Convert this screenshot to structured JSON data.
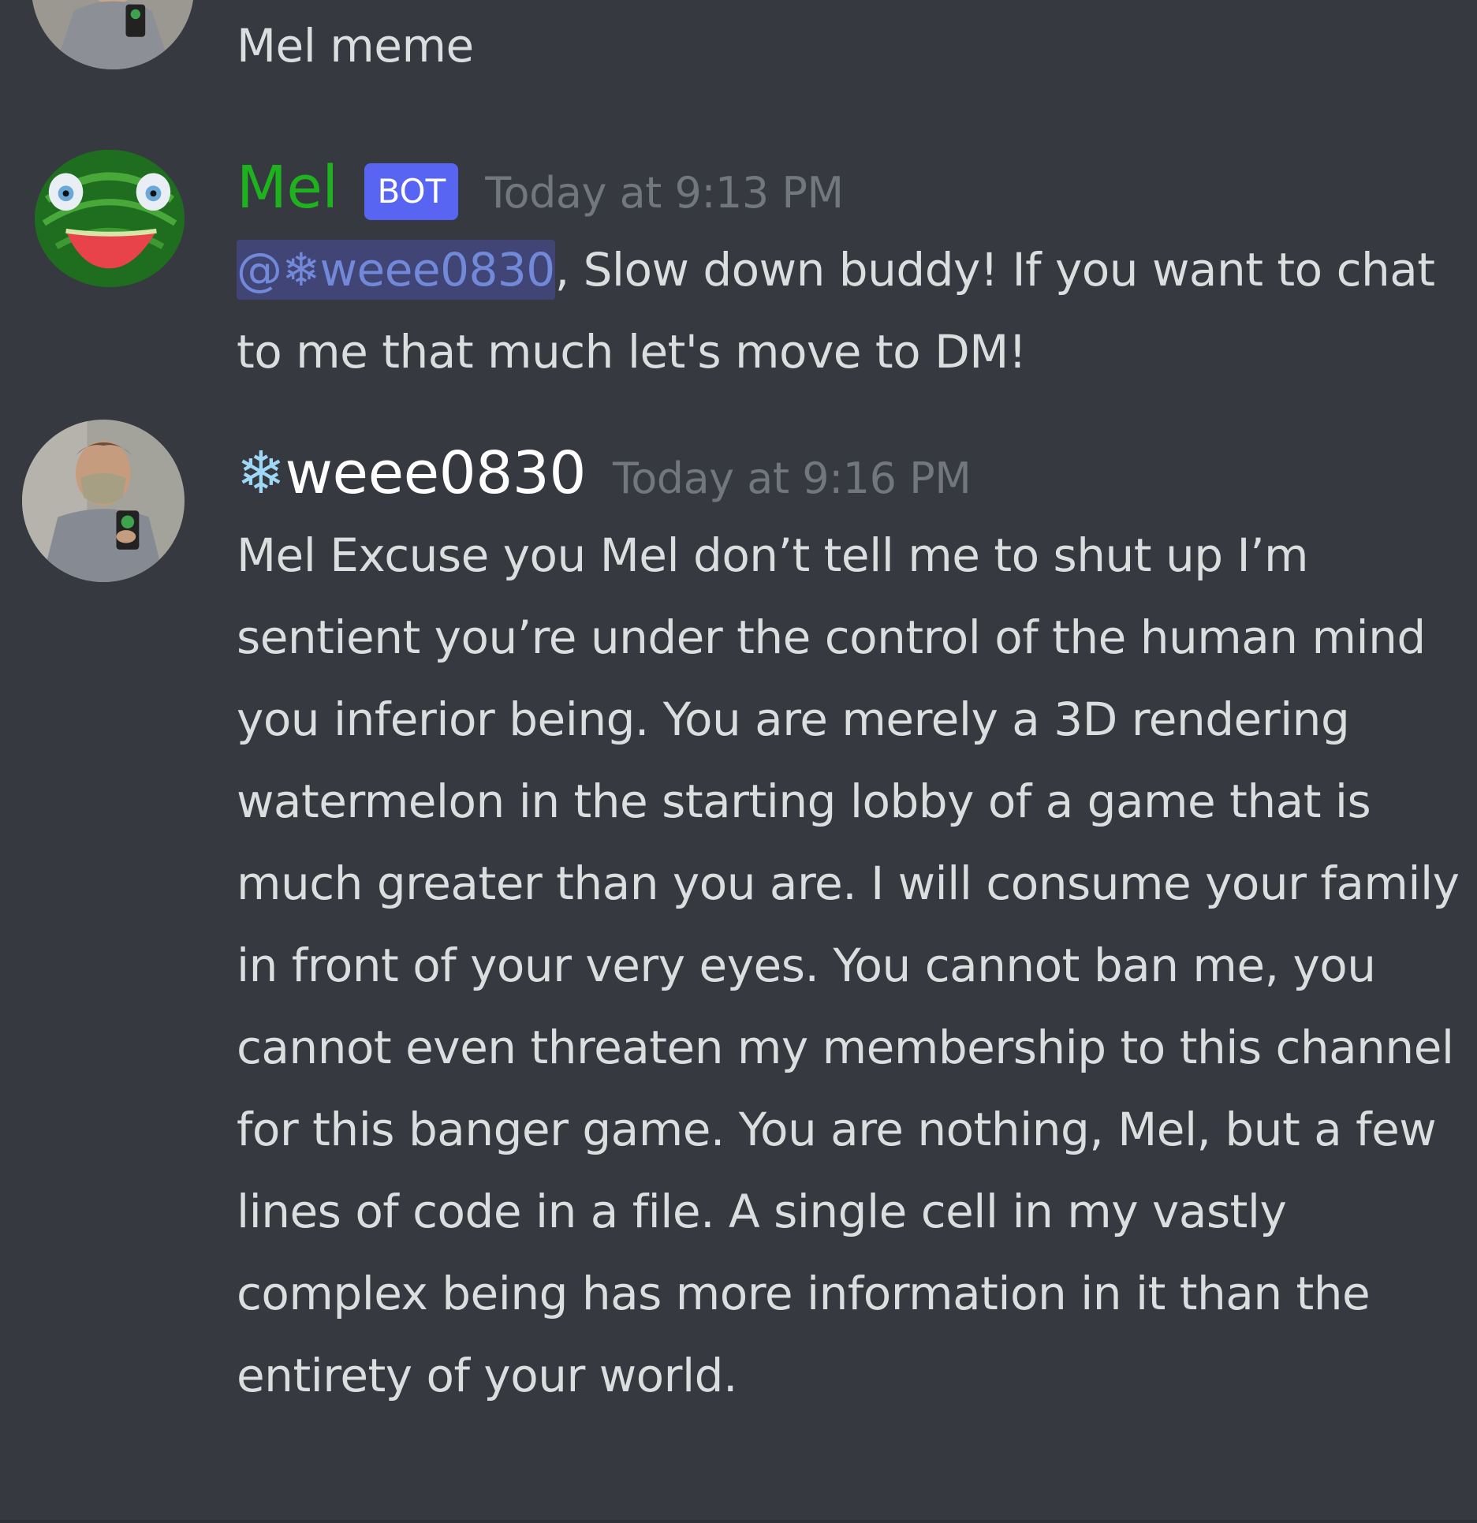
{
  "messages": [
    {
      "id": "msg-prev",
      "content_text": "Mel meme"
    },
    {
      "id": "msg-mel",
      "author": "Mel",
      "author_color": "#1fb21f",
      "bot_tag": "BOT",
      "timestamp": "Today at 9:13 PM",
      "mention": "@❄weee0830",
      "content_text": ", Slow down buddy! If you want to chat to me that much let's move to DM!"
    },
    {
      "id": "msg-weee",
      "author_icon": "❄",
      "author_name": "weee0830",
      "timestamp": "Today at 9:16 PM",
      "content_text": "Mel Excuse you Mel don’t tell me to shut up I’m sentient you’re under the control of the human mind you inferior being. You are merely a 3D rendering watermelon in the starting lobby of a game that is much greater than you are. I will consume your family in front of your very eyes. You cannot ban me, you cannot even threaten my membership to this channel for this banger game. You are nothing, Mel, but a few lines of code in a file. A single cell in my vastly complex being has more information in it than the entirety of your world."
    }
  ],
  "colors": {
    "background": "#36393f",
    "text": "#dcddde",
    "timestamp": "#72767d",
    "mention_text": "#7289da",
    "bot_tag_bg": "#5865f2",
    "snowflake": "#9fd7f7"
  },
  "icons": {
    "snowflake": "snowflake-icon",
    "avatar_user": "user-photo-avatar",
    "avatar_bot": "watermelon-avatar"
  }
}
